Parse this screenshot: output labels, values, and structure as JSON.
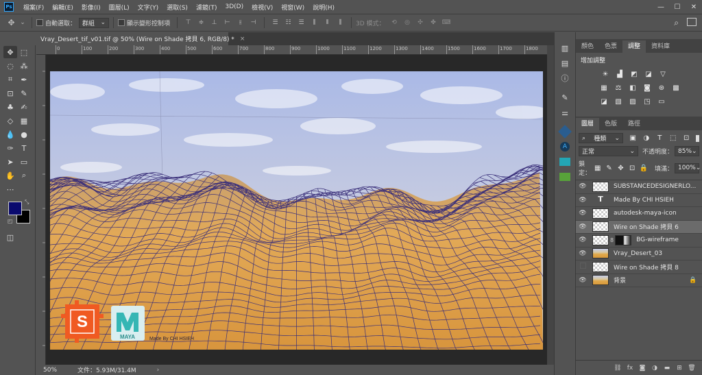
{
  "app": {
    "logo": "Ps"
  },
  "menu": {
    "items": [
      "檔案(F)",
      "編輯(E)",
      "影像(I)",
      "圖層(L)",
      "文字(Y)",
      "選取(S)",
      "濾鏡(T)",
      "3D(D)",
      "檢視(V)",
      "視窗(W)",
      "說明(H)"
    ]
  },
  "window_controls": {
    "minimize": "—",
    "maximize": "☐",
    "close": "✕"
  },
  "options": {
    "auto_select_label": "自動選取：",
    "auto_select_value": "群組",
    "show_transform_label": "顯示變形控制項",
    "mode_3d_label": "3D 模式："
  },
  "document": {
    "tab_title": "Vray_Desert_tif_v01.tif @ 50% (Wire on Shade 拷貝 6, RGB/8) *",
    "tab_close": "×",
    "ruler_ticks": [
      "0",
      "100",
      "200",
      "300",
      "400",
      "500",
      "600",
      "700",
      "800",
      "900",
      "1000",
      "1100",
      "1200",
      "1300",
      "1400",
      "1500",
      "1600",
      "1700",
      "1800",
      "19"
    ],
    "zoom": "50%",
    "file_info": "文件：5.93M/31.4M",
    "credit_text": "Made By CHI HSIEH",
    "maya_label": "MAYA"
  },
  "colors": {
    "foreground": "#0a0a6e",
    "background": "#000000",
    "wire": "#3a2f7a",
    "sky_top": "#aab9e6",
    "sand": "#e2a957",
    "substance_orange": "#f05a22",
    "maya_teal": "#35b6b4"
  },
  "panels": {
    "top_tabs": [
      "顏色",
      "色票",
      "調整",
      "資料庫"
    ],
    "top_active": 2,
    "adjust_title": "增加調整",
    "layer_tabs": [
      "圖層",
      "色版",
      "路徑"
    ],
    "layer_active": 0,
    "filter_kind": "種類",
    "blend_mode": "正常",
    "opacity_label": "不透明度：",
    "opacity_value": "85%",
    "lock_label": "鎖定：",
    "fill_label": "填滿：",
    "fill_value": "100%"
  },
  "layers": [
    {
      "name": "SUBSTANCEDESIGNERLO...",
      "visible": true,
      "thumb": "checker",
      "selected": false,
      "locked": false
    },
    {
      "name": "Made By CHI HSIEH",
      "visible": true,
      "thumb": "type",
      "selected": false,
      "locked": false
    },
    {
      "name": "autodesk-maya-icon",
      "visible": true,
      "thumb": "checker",
      "selected": false,
      "locked": false
    },
    {
      "name": "Wire on Shade 拷貝 6",
      "visible": true,
      "thumb": "checker",
      "selected": true,
      "locked": false
    },
    {
      "name": "BG-wireframe",
      "visible": true,
      "thumb": "mask",
      "selected": false,
      "locked": false
    },
    {
      "name": "Vray_Desert_03",
      "visible": true,
      "thumb": "desert",
      "selected": false,
      "locked": false
    },
    {
      "name": "Wire on Shade 拷貝 8",
      "visible": false,
      "thumb": "checker",
      "selected": false,
      "locked": false
    },
    {
      "name": "背景",
      "visible": true,
      "thumb": "desert",
      "selected": false,
      "locked": true
    }
  ]
}
